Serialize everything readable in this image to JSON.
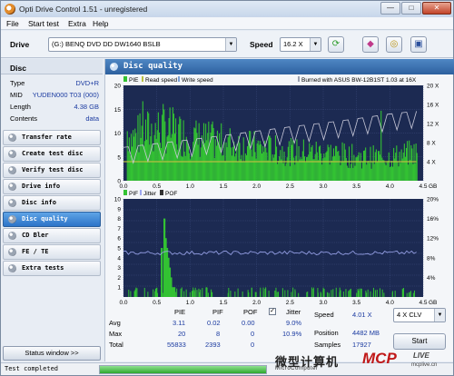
{
  "window": {
    "title": "Opti Drive Control 1.51 - unregistered",
    "min_label": "—",
    "max_label": "□",
    "close_label": "✕"
  },
  "menu": [
    "File",
    "Start test",
    "Extra",
    "Help"
  ],
  "toolbar": {
    "drive_label": "Drive",
    "drive_value": "(G:)  BENQ DVD DD DW1640 BSLB",
    "speed_label": "Speed",
    "speed_value": "16.2 X",
    "icons": [
      "refresh-icon",
      "eraser-icon",
      "disc-copy-icon",
      "save-icon"
    ]
  },
  "sidebar": {
    "header": "Disc",
    "info": [
      {
        "key": "Type",
        "value": "DVD+R"
      },
      {
        "key": "MID",
        "value": "YUDEN000 T03 (000)"
      },
      {
        "key": "Length",
        "value": "4.38 GB"
      },
      {
        "key": "Contents",
        "value": "data"
      }
    ],
    "nav": [
      {
        "label": "Transfer rate",
        "active": false
      },
      {
        "label": "Create test disc",
        "active": false
      },
      {
        "label": "Verify test disc",
        "active": false
      },
      {
        "label": "Drive info",
        "active": false
      },
      {
        "label": "Disc info",
        "active": false
      },
      {
        "label": "Disc quality",
        "active": true
      },
      {
        "label": "CD Bler",
        "active": false
      },
      {
        "label": "FE / TE",
        "active": false
      },
      {
        "label": "Extra tests",
        "active": false
      }
    ],
    "status_window_label": "Status window >>"
  },
  "panel": {
    "title": "Disc quality"
  },
  "colors": {
    "plot_bg": "#1c2a52",
    "pie": "#33c233",
    "pif": "#33c233",
    "read_speed": "#b8c040",
    "burn_curve": "#c8c8d8",
    "jitter": "#9ea8f0",
    "accent": "#2c74c8"
  },
  "chart_data": [
    {
      "type": "bar",
      "name": "PIE chart",
      "legend": [
        "PIE",
        "Read speed",
        "Write speed"
      ],
      "annotation": "Burned with ASUS BW-12B1ST 1.03 at 16X",
      "xlabel": "GB",
      "xlim": [
        0,
        4.5
      ],
      "xticks": [
        "0.0",
        "0.5",
        "1.0",
        "1.5",
        "2.0",
        "2.5",
        "3.0",
        "3.5",
        "4.0",
        "4.5"
      ],
      "ylim_left": [
        0,
        20
      ],
      "yticks_left": [
        "20",
        "15",
        "10",
        "5",
        "0"
      ],
      "ylim_right": [
        0,
        20
      ],
      "yticks_right": [
        "20 X",
        "16 X",
        "12 X",
        "8 X",
        "4 X"
      ],
      "pie_profile": [
        [
          0.0,
          12
        ],
        [
          0.1,
          9
        ],
        [
          0.3,
          10
        ],
        [
          0.6,
          11
        ],
        [
          1.0,
          9
        ],
        [
          1.5,
          8
        ],
        [
          2.0,
          7
        ],
        [
          2.5,
          6
        ],
        [
          3.0,
          6
        ],
        [
          3.5,
          5
        ],
        [
          4.0,
          5
        ],
        [
          4.4,
          6
        ]
      ],
      "pie_max": 20,
      "read_speed": [
        [
          0.0,
          4.0
        ],
        [
          0.5,
          4.0
        ],
        [
          1.0,
          4.0
        ],
        [
          2.0,
          4.0
        ],
        [
          3.0,
          4.0
        ],
        [
          4.0,
          4.0
        ],
        [
          4.4,
          4.0
        ]
      ],
      "burn_speed": [
        [
          0.0,
          7.0
        ],
        [
          0.5,
          7.8
        ],
        [
          1.0,
          8.6
        ],
        [
          1.5,
          9.5
        ],
        [
          2.0,
          10.4
        ],
        [
          2.5,
          11.3
        ],
        [
          3.0,
          12.1
        ],
        [
          3.5,
          13.0
        ],
        [
          4.0,
          14.0
        ],
        [
          4.4,
          14.6
        ]
      ]
    },
    {
      "type": "bar",
      "name": "PIF chart",
      "legend": [
        "PIF",
        "Jitter",
        "POF"
      ],
      "xlabel": "GB",
      "xlim": [
        0,
        4.5
      ],
      "xticks": [
        "0.0",
        "0.5",
        "1.0",
        "1.5",
        "2.0",
        "2.5",
        "3.0",
        "3.5",
        "4.0",
        "4.5"
      ],
      "ylim_left": [
        0,
        10
      ],
      "yticks_left": [
        "10",
        "9",
        "8",
        "7",
        "6",
        "5",
        "4",
        "3",
        "2",
        "1"
      ],
      "ylim_right": [
        4,
        20
      ],
      "yticks_right": [
        "20%",
        "16%",
        "12%",
        "8%",
        "4%"
      ],
      "pif_spikes": [
        [
          0.56,
          5
        ],
        [
          0.6,
          8
        ],
        [
          0.62,
          6
        ],
        [
          0.64,
          5
        ],
        [
          0.66,
          4
        ],
        [
          0.68,
          3
        ],
        [
          0.7,
          2
        ],
        [
          0.72,
          1
        ],
        [
          0.75,
          1
        ]
      ],
      "jitter_level": 9.0
    }
  ],
  "stats": {
    "headers": [
      "PIE",
      "PIF",
      "POF",
      "Jitter"
    ],
    "rows": [
      {
        "label": "Avg",
        "pie": "3.11",
        "pif": "0.02",
        "pof": "0.00",
        "jitter": "9.0%"
      },
      {
        "label": "Max",
        "pie": "20",
        "pif": "8",
        "pof": "0",
        "jitter": "10.9%"
      },
      {
        "label": "Total",
        "pie": "55833",
        "pif": "2393",
        "pof": "0",
        "jitter": ""
      }
    ],
    "jitter_checked": true,
    "speed_label": "Speed",
    "speed_value": "4.01 X",
    "position_label": "Position",
    "position_value": "4482 MB",
    "samples_label": "Samples",
    "samples_value": "17927",
    "mode_value": "4 X CLV",
    "start_label": "Start"
  },
  "statusbar": {
    "text": "Test completed",
    "progress": 1.0
  },
  "watermark": {
    "cn": "微型计算机",
    "en": "MicroComputer",
    "brand": "MCP",
    "brand2": "LIVE",
    "site": "mcplive.cn"
  }
}
